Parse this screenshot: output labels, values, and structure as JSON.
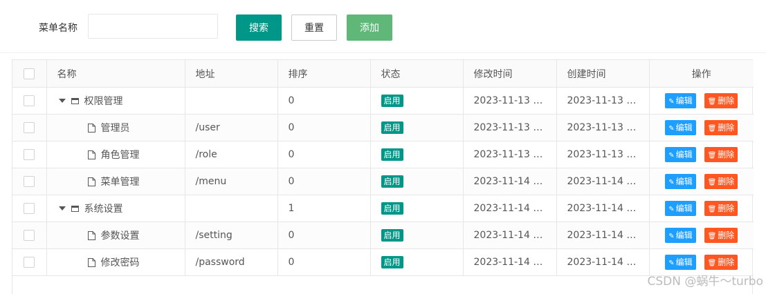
{
  "search": {
    "label": "菜单名称",
    "placeholder": "",
    "value": "",
    "search_label": "搜索",
    "reset_label": "重置",
    "add_label": "添加"
  },
  "table": {
    "columns": [
      "名称",
      "地址",
      "排序",
      "状态",
      "修改时间",
      "创建时间",
      "操作"
    ],
    "rows": [
      {
        "name": "权限管理",
        "path": "",
        "sort": "0",
        "status": "启用",
        "modified": "2023-11-13 1...",
        "created": "2023-11-13 1..."
      },
      {
        "name": "管理员",
        "path": "/user",
        "sort": "0",
        "status": "启用",
        "modified": "2023-11-13 1...",
        "created": "2023-11-13 1..."
      },
      {
        "name": "角色管理",
        "path": "/role",
        "sort": "0",
        "status": "启用",
        "modified": "2023-11-13 1...",
        "created": "2023-11-13 1..."
      },
      {
        "name": "菜单管理",
        "path": "/menu",
        "sort": "0",
        "status": "启用",
        "modified": "2023-11-14 0...",
        "created": "2023-11-14 0..."
      },
      {
        "name": "系统设置",
        "path": "",
        "sort": "1",
        "status": "启用",
        "modified": "2023-11-14 0...",
        "created": "2023-11-14 0..."
      },
      {
        "name": "参数设置",
        "path": "/setting",
        "sort": "0",
        "status": "启用",
        "modified": "2023-11-14 0...",
        "created": "2023-11-14 0..."
      },
      {
        "name": "修改密码",
        "path": "/password",
        "sort": "0",
        "status": "启用",
        "modified": "2023-11-14 0...",
        "created": "2023-11-14 0..."
      }
    ],
    "edit_label": "编辑",
    "delete_label": "删除"
  },
  "watermark": "CSDN @蜗牛～turbo",
  "colors": {
    "primary": "#009688",
    "add": "#5fb878",
    "edit": "#1e9fff",
    "delete": "#ff5722"
  },
  "icons": {
    "expand": "caret-down-icon",
    "folder": "folder-icon",
    "file": "file-icon",
    "edit": "pencil-icon",
    "delete": "trash-icon"
  }
}
